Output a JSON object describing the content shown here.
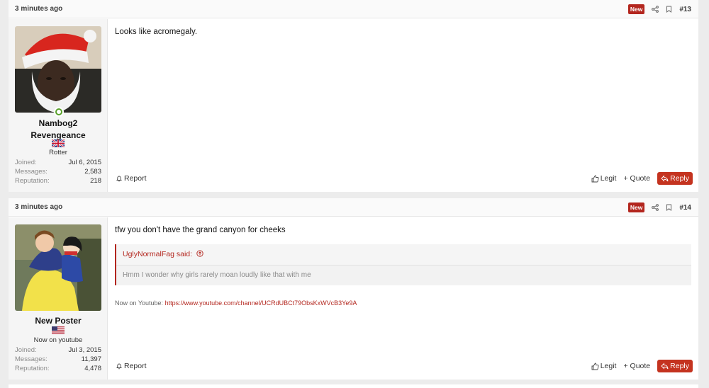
{
  "posts": [
    {
      "time": "3 minutes ago",
      "badge": "New",
      "number": "#13",
      "user": {
        "name_line1": "Nambog2",
        "name_line2": "Revengeance",
        "title": "Rotter",
        "stats": [
          {
            "label": "Joined:",
            "value": "Jul 6, 2015"
          },
          {
            "label": "Messages:",
            "value": "2,583"
          },
          {
            "label": "Reputation:",
            "value": "218"
          }
        ]
      },
      "message": "Looks like acromegaly.",
      "actions": {
        "report": "Report",
        "legit": "Legit",
        "quote": "+ Quote",
        "reply": "Reply"
      }
    },
    {
      "time": "3 minutes ago",
      "badge": "New",
      "number": "#14",
      "user": {
        "name": "New Poster",
        "title": "Now on youtube",
        "stats": [
          {
            "label": "Joined:",
            "value": "Jul 3, 2015"
          },
          {
            "label": "Messages:",
            "value": "11,397"
          },
          {
            "label": "Reputation:",
            "value": "4,478"
          }
        ]
      },
      "message": "tfw you don't have the grand canyon for cheeks",
      "quote": {
        "author": "UglyNormalFag said:",
        "text": "Hmm I wonder why girls rarely moan loudly like that with me"
      },
      "signature": {
        "prefix": "Now on Youtube: ",
        "link": "https://www.youtube.com/channel/UCRdUBCt79ObsKxWVcB3Ye9A"
      },
      "actions": {
        "report": "Report",
        "legit": "Legit",
        "quote": "+ Quote",
        "reply": "Reply"
      }
    }
  ],
  "colors": {
    "accent": "#b3261e",
    "online": "#5aa02c"
  }
}
